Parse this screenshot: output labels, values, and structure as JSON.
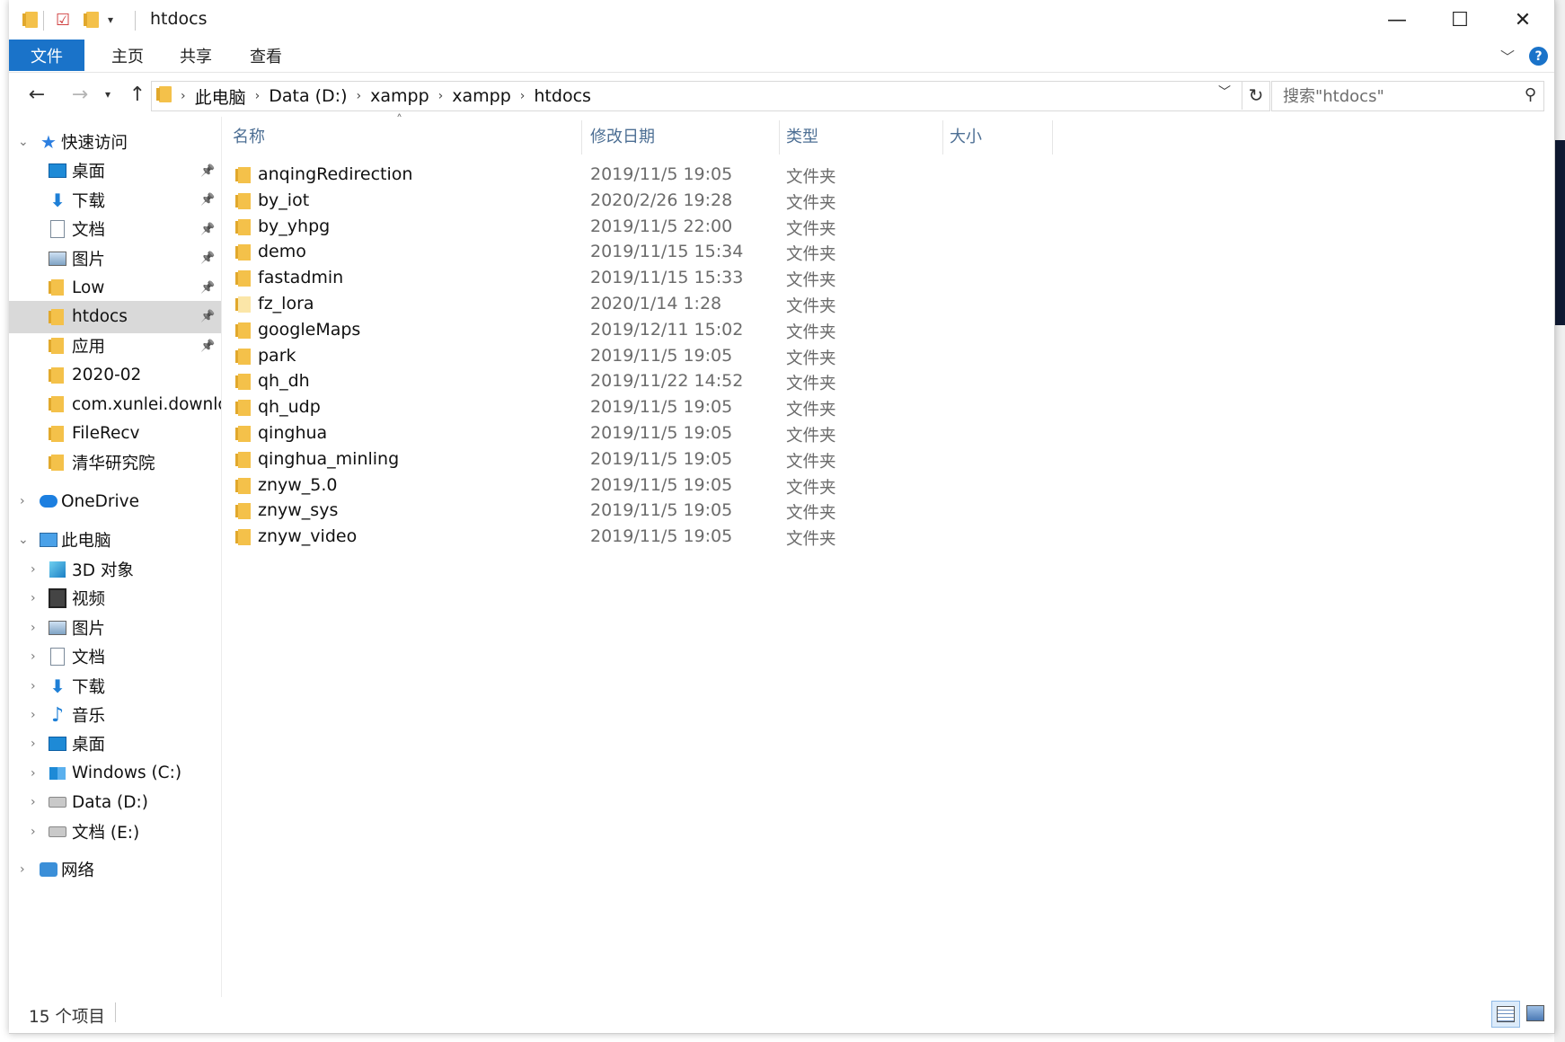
{
  "window": {
    "title": "htdocs",
    "controls": {
      "minimize": "—",
      "maximize": "☐",
      "close": "✕"
    }
  },
  "ribbon": {
    "tabs": [
      "文件",
      "主页",
      "共享",
      "查看"
    ],
    "help": "?"
  },
  "address": {
    "breadcrumb": [
      "此电脑",
      "Data (D:)",
      "xampp",
      "xampp",
      "htdocs"
    ]
  },
  "search": {
    "placeholder": "搜索\"htdocs\""
  },
  "nav": {
    "quick_access": "快速访问",
    "quick_items": [
      {
        "label": "桌面",
        "icon": "desktop-icon"
      },
      {
        "label": "下载",
        "icon": "download-icon"
      },
      {
        "label": "文档",
        "icon": "document-icon"
      },
      {
        "label": "图片",
        "icon": "pictures-icon"
      },
      {
        "label": "Low",
        "icon": "folder-icon"
      },
      {
        "label": "htdocs",
        "icon": "folder-icon",
        "selected": true
      },
      {
        "label": "应用",
        "icon": "folder-icon"
      },
      {
        "label": "2020-02",
        "icon": "folder-icon"
      },
      {
        "label": "com.xunlei.downlc",
        "icon": "folder-icon"
      },
      {
        "label": "FileRecv",
        "icon": "folder-icon"
      },
      {
        "label": "清华研究院",
        "icon": "folder-icon"
      }
    ],
    "onedrive": "OneDrive",
    "this_pc": "此电脑",
    "pc_items": [
      {
        "label": "3D 对象",
        "icon": "3d-objects-icon"
      },
      {
        "label": "视频",
        "icon": "video-icon"
      },
      {
        "label": "图片",
        "icon": "pictures-icon"
      },
      {
        "label": "文档",
        "icon": "document-icon"
      },
      {
        "label": "下载",
        "icon": "download-icon"
      },
      {
        "label": "音乐",
        "icon": "music-icon"
      },
      {
        "label": "桌面",
        "icon": "desktop-icon"
      },
      {
        "label": "Windows (C:)",
        "icon": "windows-drive-icon"
      },
      {
        "label": "Data (D:)",
        "icon": "drive-icon"
      },
      {
        "label": "文档 (E:)",
        "icon": "drive-icon"
      }
    ],
    "network": "网络"
  },
  "columns": {
    "name": "名称",
    "date": "修改日期",
    "type": "类型",
    "size": "大小"
  },
  "files": [
    {
      "name": "anqingRedirection",
      "date": "2019/11/5 19:05",
      "type": "文件夹"
    },
    {
      "name": "by_iot",
      "date": "2020/2/26 19:28",
      "type": "文件夹"
    },
    {
      "name": "by_yhpg",
      "date": "2019/11/5 22:00",
      "type": "文件夹"
    },
    {
      "name": "demo",
      "date": "2019/11/15 15:34",
      "type": "文件夹"
    },
    {
      "name": "fastadmin",
      "date": "2019/11/15 15:33",
      "type": "文件夹"
    },
    {
      "name": "fz_lora",
      "date": "2020/1/14 1:28",
      "type": "文件夹"
    },
    {
      "name": "googleMaps",
      "date": "2019/12/11 15:02",
      "type": "文件夹"
    },
    {
      "name": "park",
      "date": "2019/11/5 19:05",
      "type": "文件夹"
    },
    {
      "name": "qh_dh",
      "date": "2019/11/22 14:52",
      "type": "文件夹"
    },
    {
      "name": "qh_udp",
      "date": "2019/11/5 19:05",
      "type": "文件夹"
    },
    {
      "name": "qinghua",
      "date": "2019/11/5 19:05",
      "type": "文件夹"
    },
    {
      "name": "qinghua_minling",
      "date": "2019/11/5 19:05",
      "type": "文件夹"
    },
    {
      "name": "znyw_5.0",
      "date": "2019/11/5 19:05",
      "type": "文件夹"
    },
    {
      "name": "znyw_sys",
      "date": "2019/11/5 19:05",
      "type": "文件夹"
    },
    {
      "name": "znyw_video",
      "date": "2019/11/5 19:05",
      "type": "文件夹"
    }
  ],
  "status": {
    "count": "15 个项目"
  },
  "colors": {
    "accent": "#1a73c9",
    "header_text": "#4d6f94",
    "folder": "#f4c14a"
  }
}
